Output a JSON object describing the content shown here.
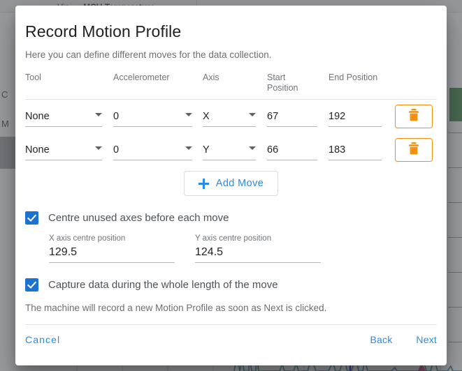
{
  "background": {
    "tabs": [
      "Vin",
      "MCU Temperature"
    ],
    "left_labels": [
      "C",
      "M"
    ],
    "accent_green": "#2e7d32",
    "chart_color": "#1f7a8c",
    "marker_color": "#2a00d0",
    "highlight_color": "#c2185b"
  },
  "dialog": {
    "title": "Record Motion Profile",
    "subtitle": "Here you can define different moves for the data collection.",
    "table": {
      "columns": [
        "Tool",
        "Accelerometer",
        "Axis",
        "Start Position",
        "End Position"
      ],
      "rows": [
        {
          "tool": "None",
          "accelerometer": "0",
          "axis": "X",
          "start_position": "67",
          "end_position": "192",
          "delete_icon": "trash-icon"
        },
        {
          "tool": "None",
          "accelerometer": "0",
          "axis": "Y",
          "start_position": "66",
          "end_position": "183",
          "delete_icon": "trash-icon"
        }
      ]
    },
    "add_move": {
      "label": "Add Move",
      "icon": "plus-icon"
    },
    "centre_axes": {
      "checked": true,
      "label": "Centre unused axes before each move",
      "x_field": {
        "label": "X axis centre position",
        "value": "129.5"
      },
      "y_field": {
        "label": "Y axis centre position",
        "value": "124.5"
      }
    },
    "capture_data": {
      "checked": true,
      "label": "Capture data during the whole length of the move"
    },
    "hint": "The machine will record a new Motion Profile as soon as Next is clicked.",
    "actions": {
      "cancel": "Cancel",
      "back": "Back",
      "next": "Next"
    },
    "colors": {
      "accent_blue": "#2b8ae6",
      "checkbox_blue": "#1a73d0",
      "delete_orange": "#f5900c"
    }
  }
}
